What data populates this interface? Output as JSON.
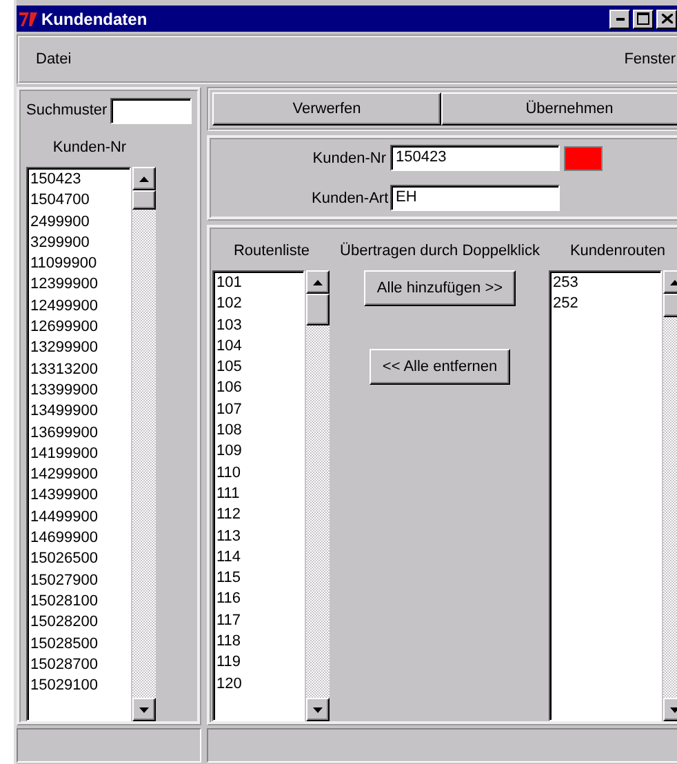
{
  "window": {
    "title": "Kundendaten"
  },
  "menu": [
    {
      "label": "Datei"
    },
    {
      "label": "Fenster"
    }
  ],
  "search": {
    "label": "Suchmuster"
  },
  "customer_list": {
    "heading": "Kunden-Nr",
    "items": [
      "150423",
      "1504700",
      "2499900",
      "3299900",
      "11099900",
      "12399900",
      "12499900",
      "12699900",
      "13299900",
      "13313200",
      "13399900",
      "13499900",
      "13699900",
      "14199900",
      "14299900",
      "14399900",
      "14499900",
      "14699900",
      "15026500",
      "15027900",
      "15028100",
      "15028200",
      "15028500",
      "15028700",
      "15029100"
    ]
  },
  "actions": [
    "Verwerfen",
    "Übernehmen"
  ],
  "customer": {
    "number_label": "Kunden-Nr",
    "number": "150423",
    "color": "#ff0000",
    "type_label": "Kunden-Art",
    "type": "EH"
  },
  "routes": {
    "list_heading": "Routenliste",
    "hint": "Übertragen durch Doppelklick",
    "assigned_heading": "Kundenrouten",
    "add_all": "Alle hinzufügen >>",
    "remove_all": "<< Alle entfernen",
    "available": [
      "101",
      "102",
      "103",
      "104",
      "105",
      "106",
      "107",
      "108",
      "109",
      "110",
      "111",
      "112",
      "113",
      "114",
      "115",
      "116",
      "117",
      "118",
      "119",
      "120"
    ],
    "assigned": [
      "253",
      "252"
    ]
  }
}
